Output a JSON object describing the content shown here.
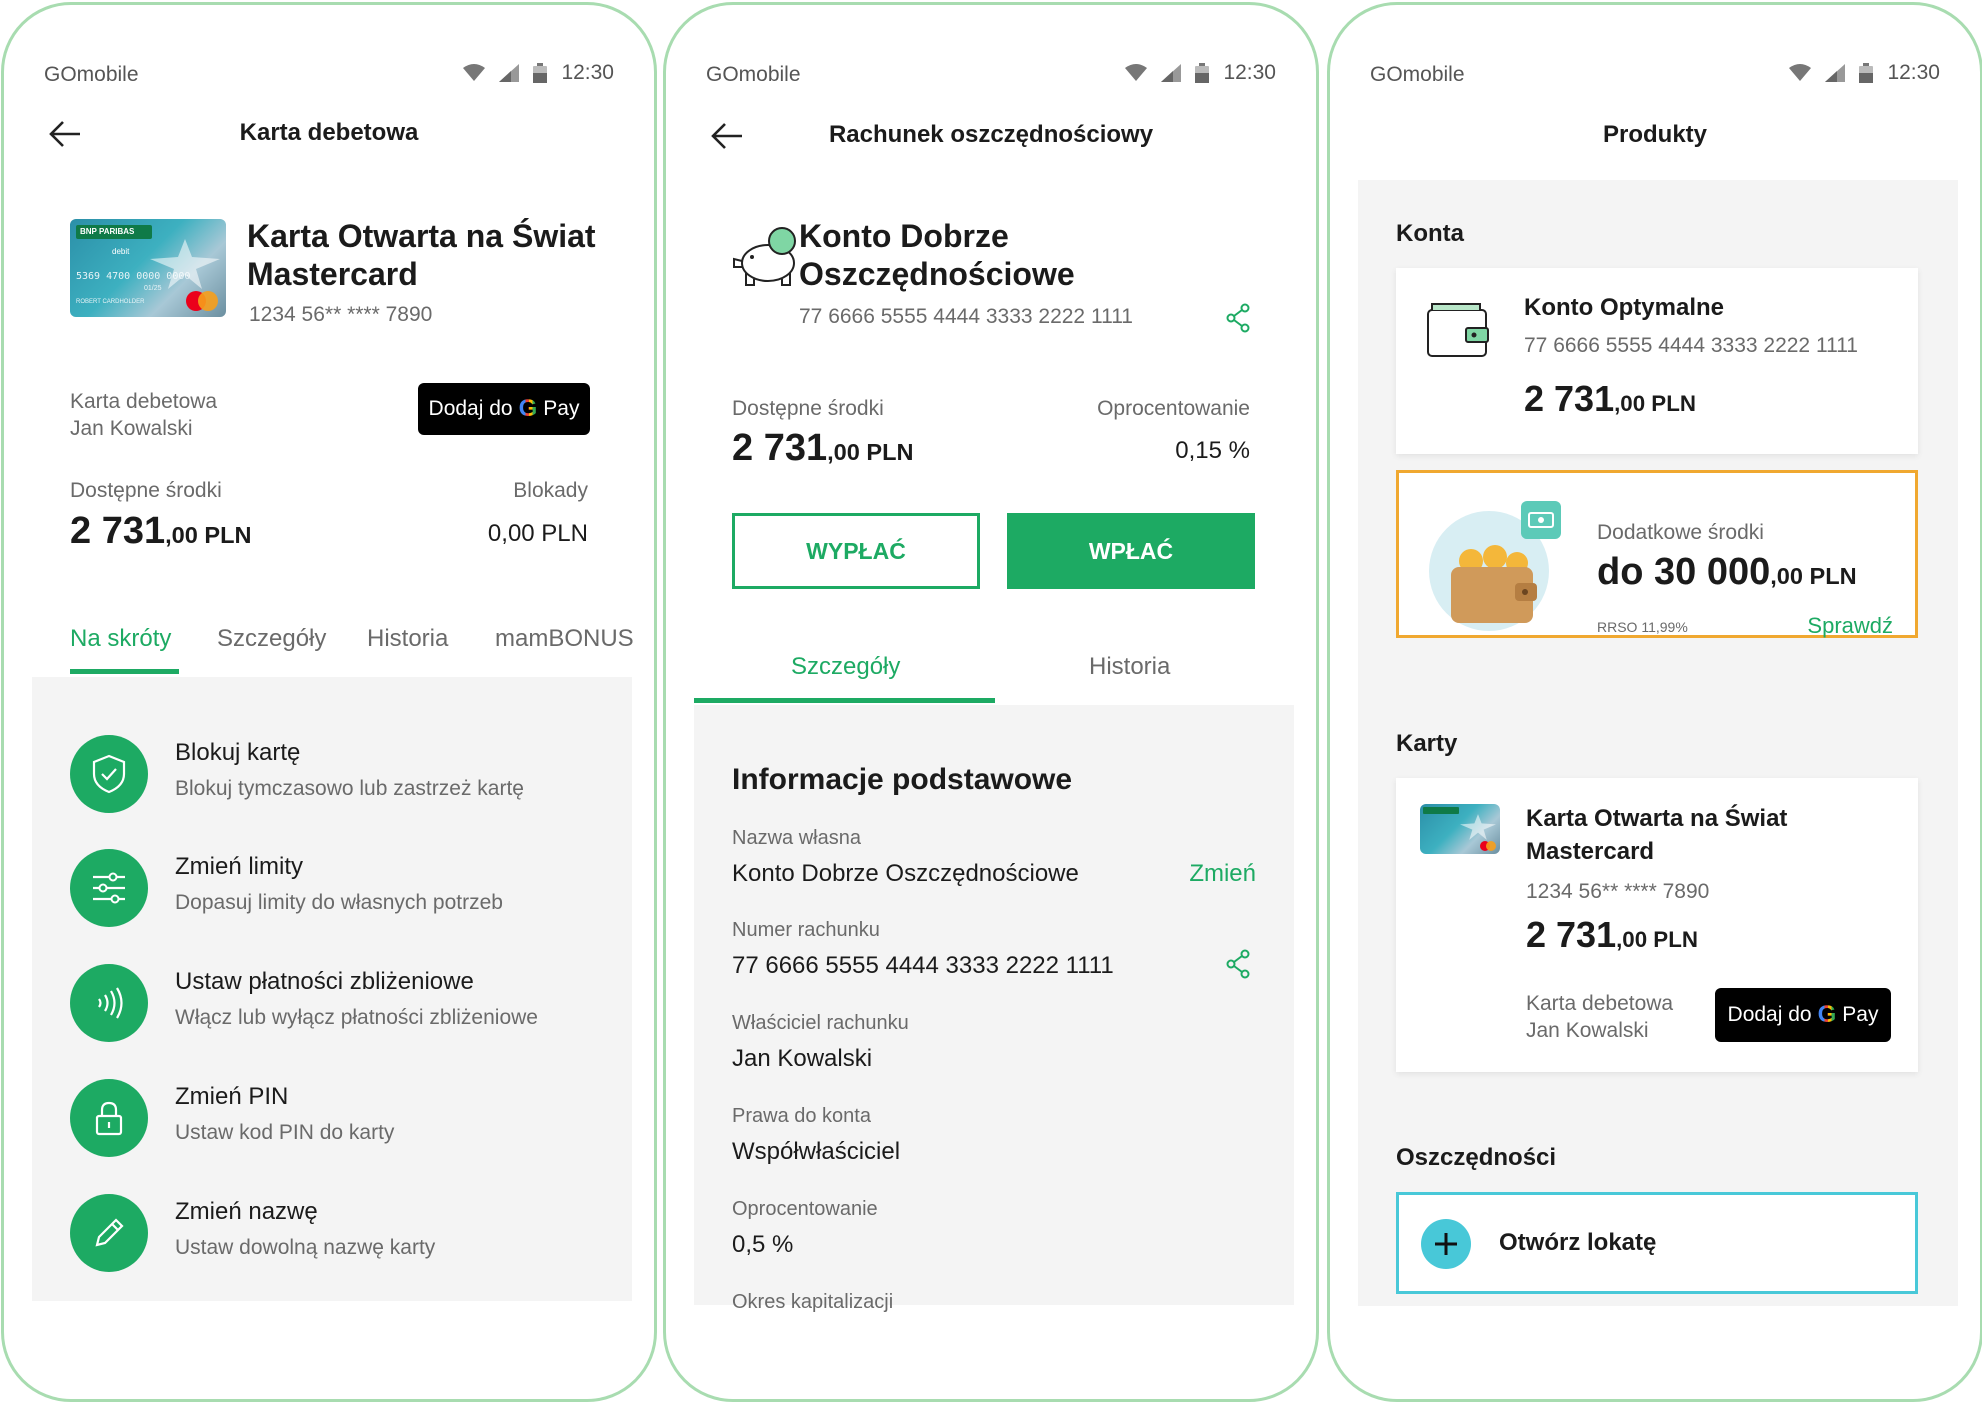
{
  "colors": {
    "accent": "#1daa63",
    "offer_border": "#f0a830",
    "deposit_border": "#48c8d8",
    "frame": "#a8dcb0"
  },
  "status": {
    "app": "GOmobile",
    "time": "12:30"
  },
  "screen1": {
    "title": "Karta debetowa",
    "card_name": "Karta Otwarta na Świat Mastercard",
    "card_number": "1234 56** **** 7890",
    "card_brand": "BNP PARIBAS",
    "card_image_text": {
      "type": "debit",
      "number": "5369 4700 0000 0000",
      "expiry": "01/25",
      "holder": "ROBERT CARDHOLDER"
    },
    "card_type": "Karta debetowa",
    "owner": "Jan Kowalski",
    "gpay_label": "Dodaj do",
    "gpay_g": "G",
    "gpay_pay": "Pay",
    "available_label": "Dostępne środki",
    "available_int": "2 731",
    "available_dec": ",00 PLN",
    "blocks_label": "Blokady",
    "blocks_value": "0,00 PLN",
    "tabs": [
      "Na skróty",
      "Szczegóły",
      "Historia",
      "mamBONUS"
    ],
    "actions": [
      {
        "icon": "shield-icon",
        "title": "Blokuj kartę",
        "sub": "Blokuj tymczasowo lub zastrzeż kartę"
      },
      {
        "icon": "sliders-icon",
        "title": "Zmień limity",
        "sub": "Dopasuj limity do własnych potrzeb"
      },
      {
        "icon": "contactless-icon",
        "title": "Ustaw płatności zbliżeniowe",
        "sub": "Włącz lub wyłącz płatności zbliżeniowe"
      },
      {
        "icon": "lock-icon",
        "title": "Zmień PIN",
        "sub": "Ustaw kod PIN do karty"
      },
      {
        "icon": "pencil-icon",
        "title": "Zmień nazwę",
        "sub": "Ustaw dowolną nazwę karty"
      }
    ]
  },
  "screen2": {
    "title": "Rachunek oszczędnościowy",
    "account_name_l1": "Konto Dobrze",
    "account_name_l2": "Oszczędnościowe",
    "account_number": "77 6666 5555 4444 3333 2222 1111",
    "available_label": "Dostępne środki",
    "available_int": "2 731",
    "available_dec": ",00 PLN",
    "interest_label": "Oprocentowanie",
    "interest_value": "0,15 %",
    "withdraw": "WYPŁAĆ",
    "deposit": "WPŁAĆ",
    "tabs": [
      "Szczegóły",
      "Historia"
    ],
    "section": "Informacje podstawowe",
    "fields": [
      {
        "label": "Nazwa własna",
        "value": "Konto Dobrze Oszczędnościowe",
        "action": "Zmień"
      },
      {
        "label": "Numer rachunku",
        "value": "77 6666 5555 4444 3333 2222 1111"
      },
      {
        "label": "Właściciel rachunku",
        "value": "Jan Kowalski"
      },
      {
        "label": "Prawa do konta",
        "value": "Współwłaściciel"
      },
      {
        "label": "Oprocentowanie",
        "value": "0,5 %"
      },
      {
        "label": "Okres kapitalizacji"
      }
    ]
  },
  "screen3": {
    "title": "Produkty",
    "accounts_header": "Konta",
    "account": {
      "name": "Konto Optymalne",
      "number": "77 6666 5555 4444 3333 2222 1111",
      "int": "2 731",
      "dec": ",00 PLN"
    },
    "offer": {
      "label": "Dodatkowe środki",
      "prefix": "do",
      "int": "30 000",
      "dec": ",00 PLN",
      "rrso": "RRSO 11,99%",
      "cta": "Sprawdź"
    },
    "cards_header": "Karty",
    "card": {
      "name": "Karta Otwarta na Świat Mastercard",
      "number": "1234 56** **** 7890",
      "int": "2 731",
      "dec": ",00 PLN",
      "type": "Karta debetowa",
      "owner": "Jan Kowalski"
    },
    "savings_header": "Oszczędności",
    "open_deposit": "Otwórz lokatę"
  }
}
